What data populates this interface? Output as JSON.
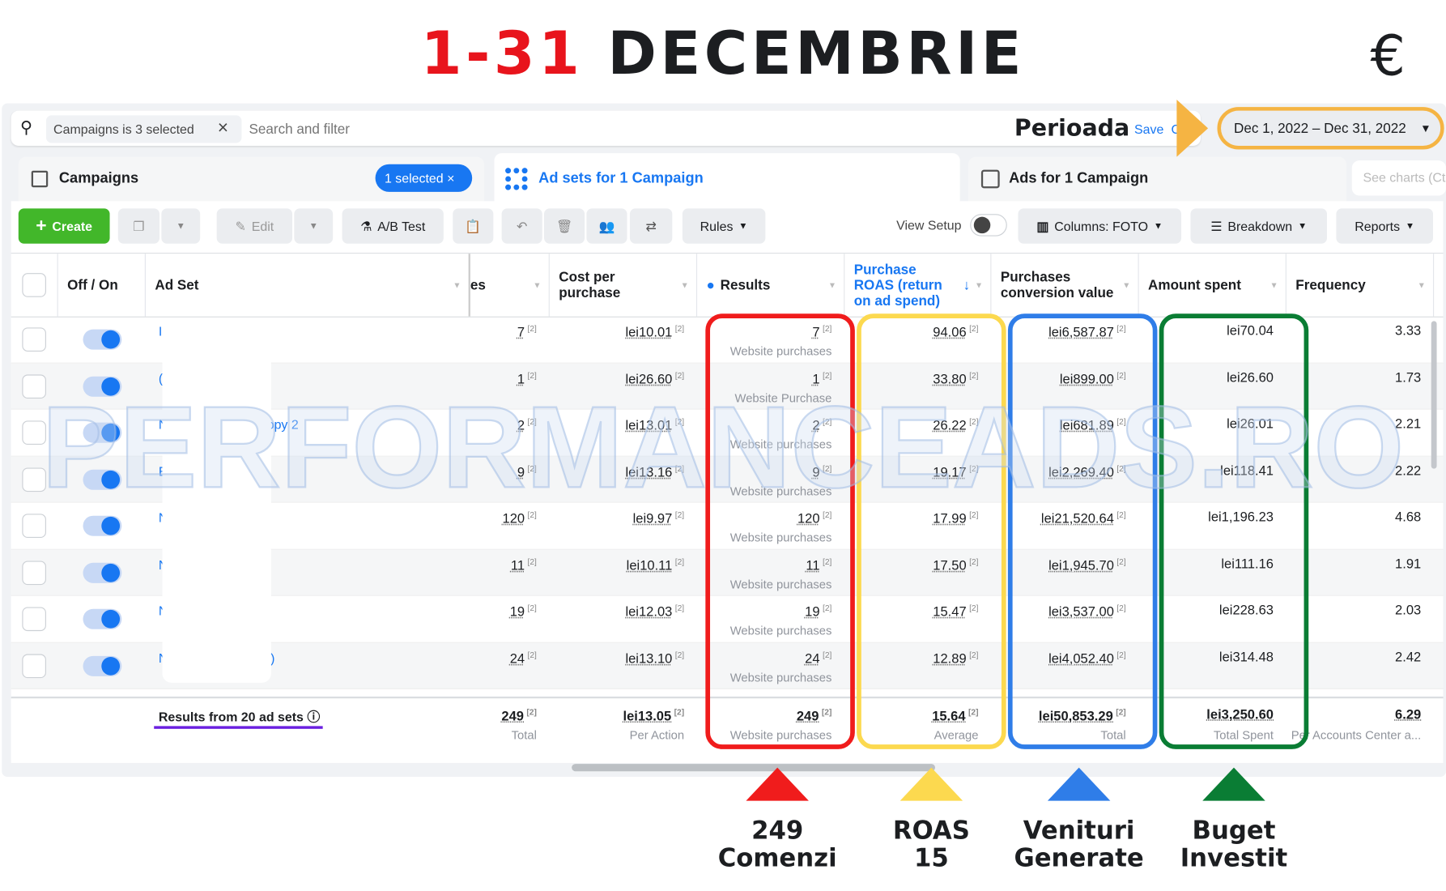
{
  "banner": {
    "title_red": "1-31",
    "title_black": "DECEMBRIE",
    "currency": "€",
    "period_label": "Perioada"
  },
  "search": {
    "chip": "Campaigns is 3 selected",
    "placeholder": "Search and filter",
    "save": "Save",
    "clear": "C",
    "date_range": "Dec 1, 2022 – Dec 31, 2022"
  },
  "tabs": {
    "campaigns": "Campaigns",
    "selected_badge": "1 selected",
    "adsets": "Ad sets for 1 Campaign",
    "ads": "Ads for 1 Campaign",
    "see_charts": "See charts (Ct"
  },
  "toolbar": {
    "create": "Create",
    "edit": "Edit",
    "ab_test": "A/B Test",
    "rules": "Rules",
    "view_setup": "View Setup",
    "columns": "Columns: FOTO",
    "breakdown": "Breakdown",
    "reports": "Reports"
  },
  "columns": {
    "off_on": "Off / On",
    "ad_set": "Ad Set",
    "purchases_partial": "es",
    "cost_per_purchase": "Cost per purchase",
    "results": "Results",
    "roas": "Purchase ROAS (return on ad spend)",
    "conv_value": "Purchases conversion value",
    "amount_spent": "Amount spent",
    "frequency": "Frequency"
  },
  "rows": [
    {
      "name": "I",
      "purchases": "7",
      "cpp": "lei10.01",
      "results": "7",
      "results_type": "Website purchases",
      "roas": "94.06",
      "value": "lei6,587.87",
      "spent": "lei70.04",
      "freq": "3.33"
    },
    {
      "name": "(",
      "purchases": "1",
      "cpp": "lei26.60",
      "results": "1",
      "results_type": "Website Purchase",
      "roas": "33.80",
      "value": "lei899.00",
      "spent": "lei26.60",
      "freq": "1.73"
    },
    {
      "name": "N                         Copy 2",
      "purchases": "2",
      "cpp": "lei13.01",
      "results": "2",
      "results_type": "Website purchases",
      "roas": "26.22",
      "value": "lei681.89",
      "spent": "lei26.01",
      "freq": "2.21"
    },
    {
      "name": "E",
      "purchases": "9",
      "cpp": "lei13.16",
      "results": "9",
      "results_type": "Website purchases",
      "roas": "19.17",
      "value": "lei2,269.40",
      "spent": "lei118.41",
      "freq": "2.22"
    },
    {
      "name": "N",
      "purchases": "120",
      "cpp": "lei9.97",
      "results": "120",
      "results_type": "Website purchases",
      "roas": "17.99",
      "value": "lei21,520.64",
      "spent": "lei1,196.23",
      "freq": "4.68"
    },
    {
      "name": "N                         ist",
      "purchases": "11",
      "cpp": "lei10.11",
      "results": "11",
      "results_type": "Website purchases",
      "roas": "17.50",
      "value": "lei1,945.70",
      "spent": "lei111.16",
      "freq": "1.91"
    },
    {
      "name": "N",
      "purchases": "19",
      "cpp": "lei12.03",
      "results": "19",
      "results_type": "Website purchases",
      "roas": "15.47",
      "value": "lei3,537.00",
      "spent": "lei228.63",
      "freq": "2.03"
    },
    {
      "name": "N                         cs)",
      "purchases": "24",
      "cpp": "lei13.10",
      "results": "24",
      "results_type": "Website purchases",
      "roas": "12.89",
      "value": "lei4,052.40",
      "spent": "lei314.48",
      "freq": "2.42"
    }
  ],
  "footer": {
    "label": "Results from 20 ad sets",
    "purchases": "249",
    "purchases_sub": "Total",
    "cpp": "lei13.05",
    "cpp_sub": "Per Action",
    "results": "249",
    "results_sub": "Website purchases",
    "roas": "15.64",
    "roas_sub": "Average",
    "value": "lei50,853.29",
    "value_sub": "Total",
    "spent": "lei3,250.60",
    "spent_sub": "Total Spent",
    "freq": "6.29",
    "freq_sub": "Per Accounts Center a..."
  },
  "annotations": [
    {
      "line1": "249",
      "line2": "Comenzi",
      "color": "#f01c1c"
    },
    {
      "line1": "ROAS",
      "line2": "15",
      "color": "#fcd94f"
    },
    {
      "line1": "Venituri",
      "line2": "Generate",
      "color": "#2f7de8"
    },
    {
      "line1": "Buget",
      "line2": "Investit",
      "color": "#0a7d34"
    }
  ],
  "watermark": "PERFORMANCEADS.RO",
  "colors": {
    "accent": "#1877f2",
    "create": "#42b72a",
    "date_highlight": "#f5b443"
  }
}
